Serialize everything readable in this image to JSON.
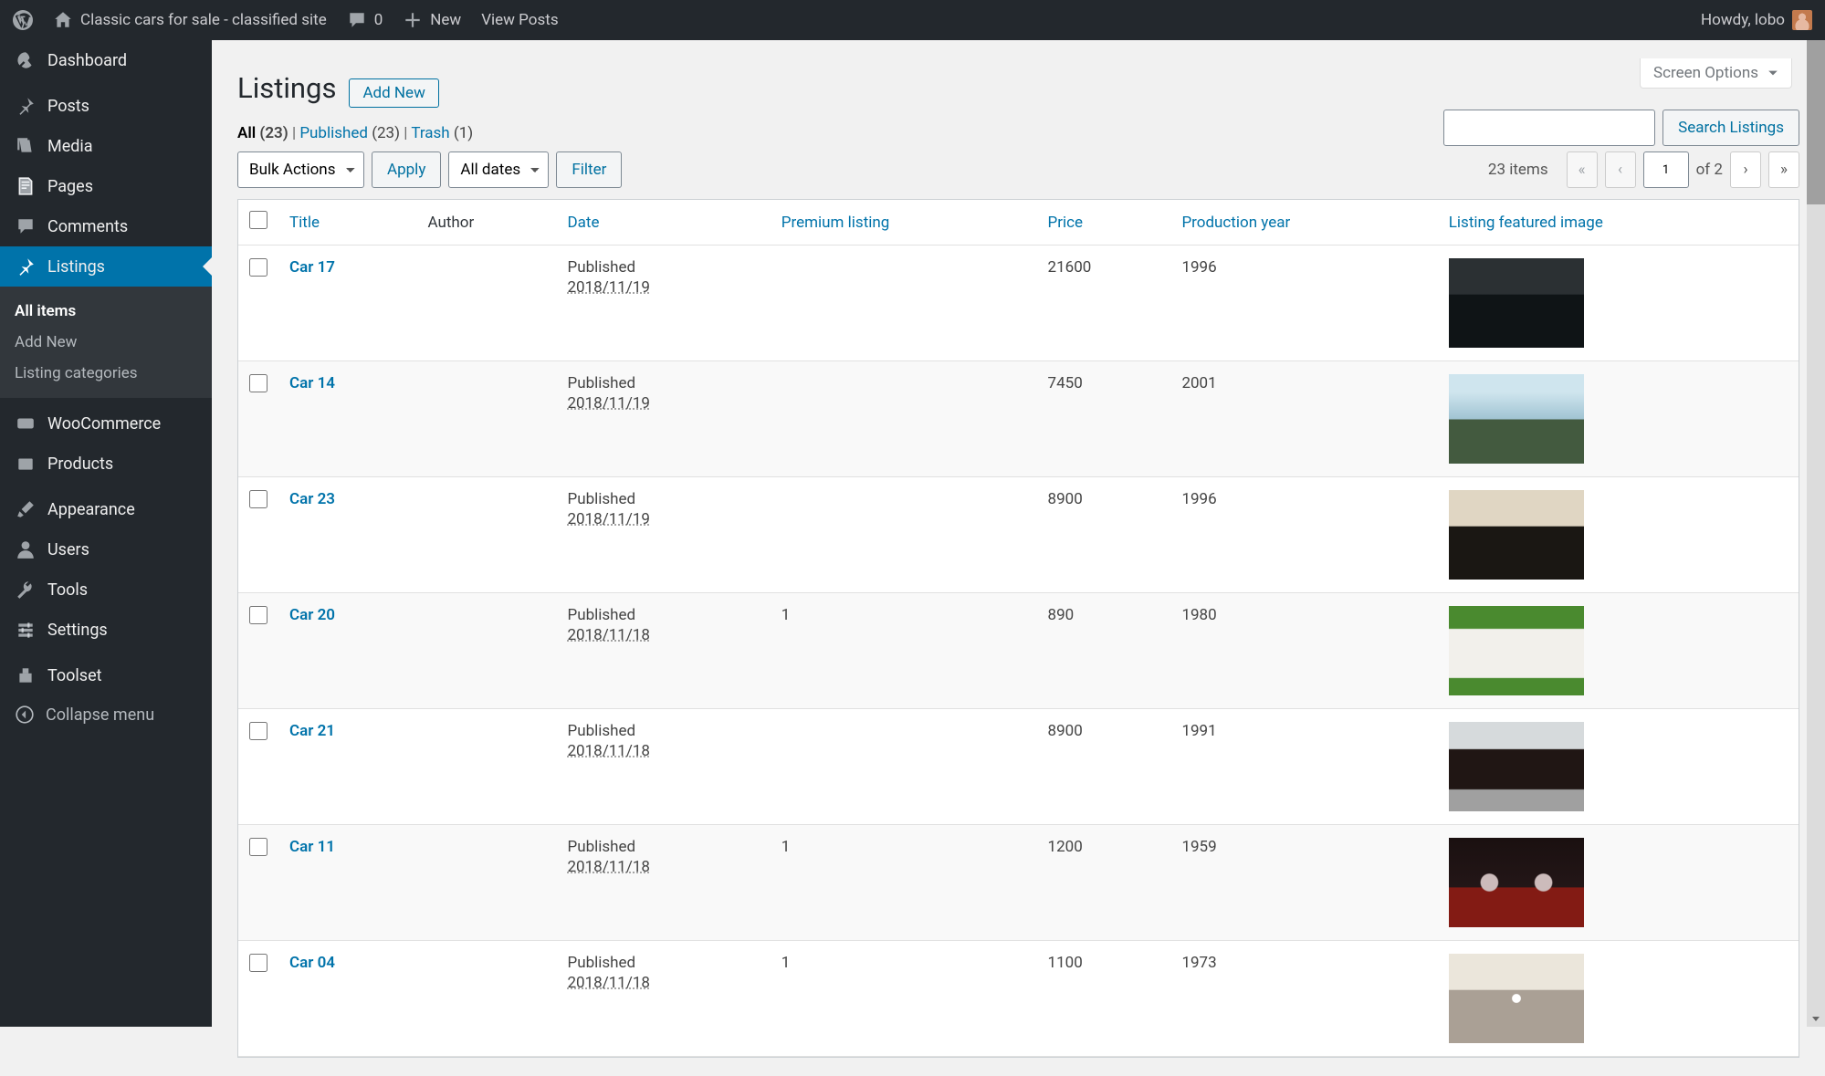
{
  "adminbar": {
    "site_title": "Classic cars for sale - classified site",
    "comments_count": "0",
    "new_label": "New",
    "view_posts_label": "View Posts",
    "greeting": "Howdy, lobo"
  },
  "sidebar": {
    "items": [
      {
        "id": "dashboard",
        "label": "Dashboard"
      },
      {
        "id": "posts",
        "label": "Posts"
      },
      {
        "id": "media",
        "label": "Media"
      },
      {
        "id": "pages",
        "label": "Pages"
      },
      {
        "id": "comments",
        "label": "Comments"
      },
      {
        "id": "listings",
        "label": "Listings"
      },
      {
        "id": "woocommerce",
        "label": "WooCommerce"
      },
      {
        "id": "products",
        "label": "Products"
      },
      {
        "id": "appearance",
        "label": "Appearance"
      },
      {
        "id": "users",
        "label": "Users"
      },
      {
        "id": "tools",
        "label": "Tools"
      },
      {
        "id": "settings",
        "label": "Settings"
      },
      {
        "id": "toolset",
        "label": "Toolset"
      }
    ],
    "submenu": {
      "all_items": "All items",
      "add_new": "Add New",
      "categories": "Listing categories"
    },
    "collapse_label": "Collapse menu"
  },
  "screen_options_label": "Screen Options",
  "page_title": "Listings",
  "add_new_label": "Add New",
  "filters": {
    "all_label": "All",
    "all_count": "(23)",
    "published_label": "Published",
    "published_count": "(23)",
    "trash_label": "Trash",
    "trash_count": "(1)",
    "sep": " | "
  },
  "bulk_actions_label": "Bulk Actions",
  "apply_label": "Apply",
  "all_dates_label": "All dates",
  "filter_label": "Filter",
  "search_button": "Search Listings",
  "items_count": "23 items",
  "page_current": "1",
  "page_total": "of 2",
  "columns": {
    "title": "Title",
    "author": "Author",
    "date": "Date",
    "premium": "Premium listing",
    "price": "Price",
    "year": "Production year",
    "image": "Listing featured image"
  },
  "published_word": "Published",
  "rows": [
    {
      "title": "Car 17",
      "date": "2018/11/19",
      "premium": "",
      "price": "21600",
      "year": "1996",
      "thumb": "vintage-dark"
    },
    {
      "title": "Car 14",
      "date": "2018/11/19",
      "premium": "",
      "price": "7450",
      "year": "2001",
      "thumb": "light-blue"
    },
    {
      "title": "Car 23",
      "date": "2018/11/19",
      "premium": "",
      "price": "8900",
      "year": "1996",
      "thumb": "hotrod"
    },
    {
      "title": "Car 20",
      "date": "2018/11/18",
      "premium": "1",
      "price": "890",
      "year": "1980",
      "thumb": "white"
    },
    {
      "title": "Car 21",
      "date": "2018/11/18",
      "premium": "",
      "price": "8900",
      "year": "1991",
      "thumb": "brown"
    },
    {
      "title": "Car 11",
      "date": "2018/11/18",
      "premium": "1",
      "price": "1200",
      "year": "1959",
      "thumb": "headlights"
    },
    {
      "title": "Car 04",
      "date": "2018/11/18",
      "premium": "1",
      "price": "1100",
      "year": "1973",
      "thumb": "tan"
    }
  ]
}
